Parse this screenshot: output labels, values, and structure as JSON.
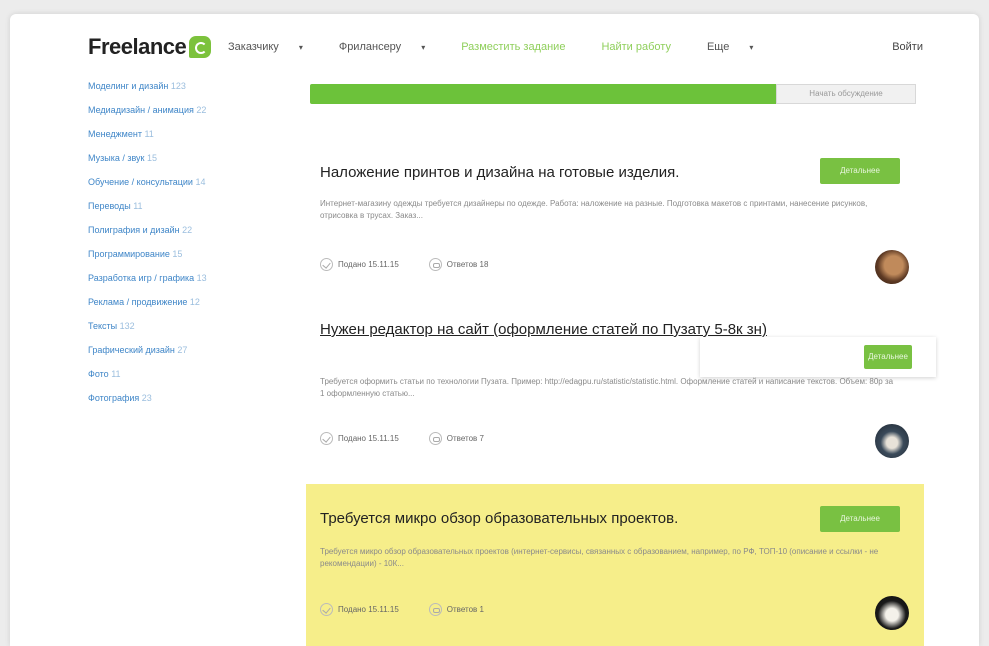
{
  "header": {
    "logo": "Freelance",
    "nav": [
      {
        "label": "Заказчику",
        "chevron": true,
        "style": "dark"
      },
      {
        "label": "Фрилансеру",
        "chevron": true,
        "style": "dark"
      },
      {
        "label": "Разместить задание",
        "chevron": false,
        "style": "green"
      },
      {
        "label": "Найти работу",
        "chevron": false,
        "style": "green"
      },
      {
        "label": "Еще",
        "chevron": true,
        "style": "dark"
      }
    ],
    "login": "Войти"
  },
  "sidebar": {
    "categories": [
      {
        "label": "Моделинг и дизайн",
        "count": "123"
      },
      {
        "label": "Медиадизайн / анимация",
        "count": "22"
      },
      {
        "label": "Менеджмент",
        "count": "11"
      },
      {
        "label": "Музыка / звук",
        "count": "15"
      },
      {
        "label": "Обучение / консультации",
        "count": "14"
      },
      {
        "label": "Переводы",
        "count": "11"
      },
      {
        "label": "Полиграфия и дизайн",
        "count": "22"
      },
      {
        "label": "Программирование",
        "count": "15"
      },
      {
        "label": "Разработка игр / графика",
        "count": "13"
      },
      {
        "label": "Реклама / продвижение",
        "count": "12"
      },
      {
        "label": "Тексты",
        "count": "132"
      },
      {
        "label": "Графический дизайн",
        "count": "27"
      },
      {
        "label": "Фото",
        "count": "11"
      },
      {
        "label": "Фотография",
        "count": "23"
      }
    ]
  },
  "progress": {
    "fill_fraction": 0.77,
    "button_label": "Начать обсуждение",
    "fill_color": "#6cc23a"
  },
  "projects": [
    {
      "title": "Наложение принтов и дизайна на готовые изделия.",
      "description": "Интернет-магазину одежды требуется дизайнеры по одежде. Работа: наложение на разные. Подготовка макетов с принтами, нанесение рисунков, отрисовка в трусах. Заказ...",
      "button": "Детальнее",
      "date": "Подано 15.11.15",
      "replies": "Ответов 18",
      "highlighted": false
    },
    {
      "title": "Нужен редактор на сайт (оформление статей по Пузату 5-8к зн)",
      "description": "Требуется оформить статьи по технологии Пузата. Пример: http://edagpu.ru/statistic/statistic.html. Оформление статей и написание текстов. Объем: 80р за 1 оформленную статью...",
      "button": "Детальнее",
      "date": "Подано 15.11.15",
      "replies": "Ответов 7",
      "highlighted": false
    },
    {
      "title": "Требуется микро обзор образовательных проектов.",
      "description": "Требуется микро обзор образовательных проектов (интернет-сервисы, связанных с образованием, например, по РФ, ТОП-10 (описание и ссылки - не рекомендации) - 10К...",
      "button": "Детальнее",
      "date": "Подано 15.11.15",
      "replies": "Ответов 1",
      "highlighted": true
    }
  ],
  "colors": {
    "accent": "#79c142",
    "highlight": "#f6ee8a",
    "link": "#3f86c8"
  }
}
